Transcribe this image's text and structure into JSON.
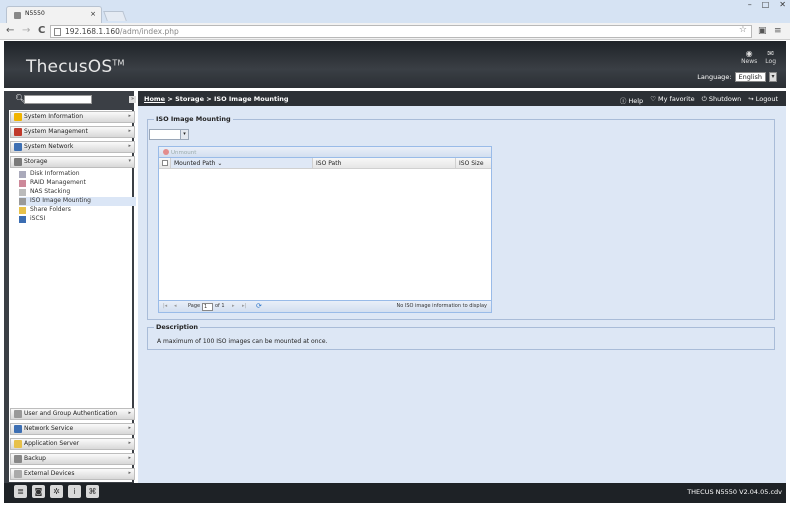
{
  "browser": {
    "tab_title": "N5550",
    "tab_close": "×",
    "url_host": "192.168.1.160",
    "url_path": "/adm/index.php",
    "back": "←",
    "forward": "→",
    "reload": "C"
  },
  "header": {
    "logo": "ThecusOS",
    "logo_tm": "TM",
    "news_label": "News",
    "log_label": "Log",
    "language_label": "Language:",
    "language_value": "English"
  },
  "sidebar": {
    "search_placeholder": "",
    "top_items": [
      {
        "label": "System Information",
        "icon": "info-icon",
        "color": "#f0b400"
      },
      {
        "label": "System Management",
        "icon": "tools-icon",
        "color": "#c0392b"
      },
      {
        "label": "System Network",
        "icon": "network-icon",
        "color": "#3d6fb3"
      },
      {
        "label": "Storage",
        "icon": "storage-icon",
        "color": "#7a7a7a"
      }
    ],
    "storage_subitems": [
      {
        "label": "Disk Information"
      },
      {
        "label": "RAID Management"
      },
      {
        "label": "NAS Stacking"
      },
      {
        "label": "ISO Image Mounting"
      },
      {
        "label": "Share Folders"
      },
      {
        "label": "iSCSI"
      }
    ],
    "bottom_items": [
      {
        "label": "User and Group Authentication"
      },
      {
        "label": "Network Service"
      },
      {
        "label": "Application Server"
      },
      {
        "label": "Backup"
      },
      {
        "label": "External Devices"
      }
    ]
  },
  "breadcrumb": {
    "home": "Home",
    "sep": " > ",
    "level1": "Storage",
    "level2": "ISO Image Mounting"
  },
  "tools": {
    "help": "Help",
    "favorite": "My favorite",
    "shutdown": "Shutdown",
    "logout": "Logout"
  },
  "iso_panel": {
    "legend": "ISO Image Mounting",
    "unmount_label": "Unmount",
    "columns": [
      "Mounted Path",
      "ISO Path",
      "ISO Size"
    ],
    "pager_page_label": "Page",
    "pager_page_value": "1",
    "pager_of": "of 1",
    "empty_message": "No ISO image information to display"
  },
  "description": {
    "legend": "Description",
    "text": "A maximum of 100 ISO images can be mounted at once."
  },
  "footer": {
    "version": "THECUS N5550 V2.04.05.cdv"
  }
}
